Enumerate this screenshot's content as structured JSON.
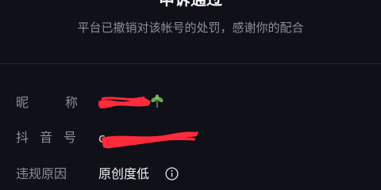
{
  "header": {
    "title": "申诉通过",
    "subtitle": "平台已撤销对该帐号的处罚，感谢你的配合"
  },
  "details": {
    "nickname_label_chars": [
      "昵",
      "称"
    ],
    "douyin_id_label": "抖音号",
    "douyin_id_partial": "c",
    "violation_label": "违规原因",
    "violation_value": "原创度低"
  },
  "icons": {
    "leaf": "leaf-icon",
    "info": "info-icon"
  },
  "colors": {
    "background": "#0f1018",
    "label": "#8d8f98",
    "value": "#f2f2f4",
    "redaction": "#ff2a3a"
  }
}
